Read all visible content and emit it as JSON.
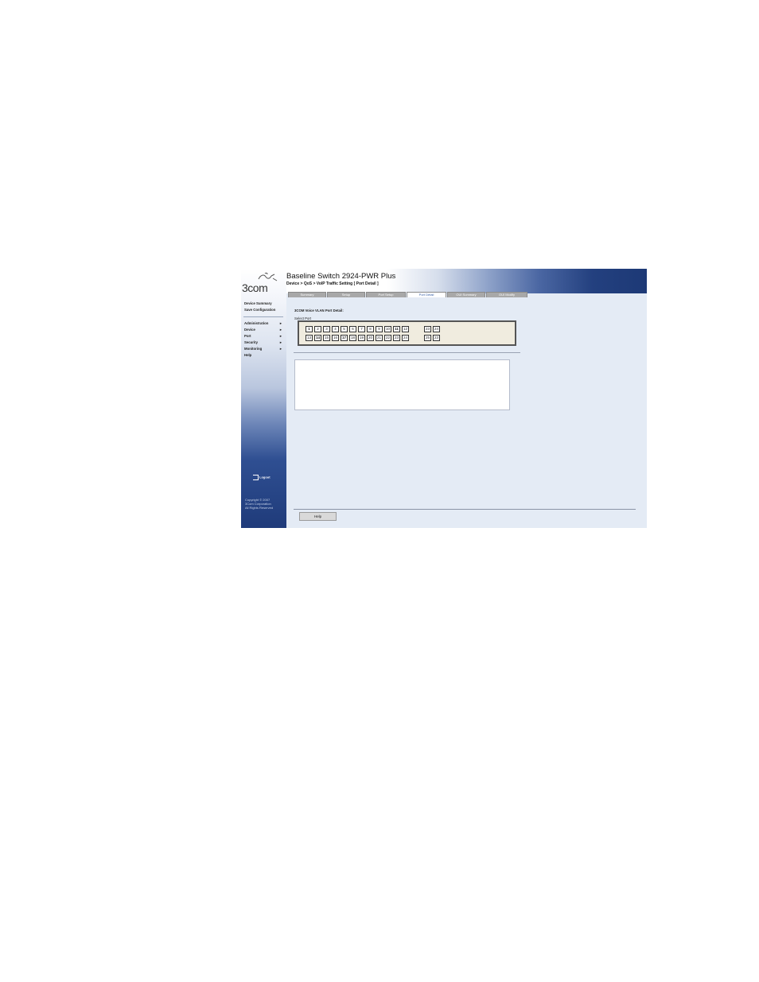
{
  "logo": {
    "text": "3com"
  },
  "sidebar": {
    "links": [
      "Device Summary",
      "Save Configuration"
    ],
    "menus": [
      "Administration",
      "Device",
      "Port",
      "Security",
      "Monitoring",
      "Help"
    ],
    "menu_arrow": "►",
    "logout_label": "Logout",
    "copyright": [
      "Copyright © 2007",
      "3Com Corporation",
      "All Rights Reserved"
    ]
  },
  "header": {
    "title": "Baseline Switch 2924-PWR Plus",
    "breadcrumb": "Device > QoS > VoIP Traffic Setting [ Port Detail ]"
  },
  "tabs": [
    "Summary",
    "Setup",
    "Port Setup",
    "Port Detail",
    "OUI Summary",
    "OUI Modify"
  ],
  "active_tab": "Port Detail",
  "content": {
    "section_title": "3COM Voice VLAN Port Detail:",
    "select_label": "Select Port",
    "ports_top": [
      "1",
      "2",
      "3",
      "4",
      "5",
      "6",
      "7",
      "8",
      "9",
      "10",
      "11",
      "12"
    ],
    "ports_bottom": [
      "13",
      "14",
      "15",
      "16",
      "17",
      "18",
      "19",
      "20",
      "21",
      "22",
      "23",
      "24"
    ],
    "uplink_top": [
      "23",
      "24"
    ],
    "uplink_bottom": [
      "25",
      "23"
    ]
  },
  "footer": {
    "help_label": "Help"
  }
}
